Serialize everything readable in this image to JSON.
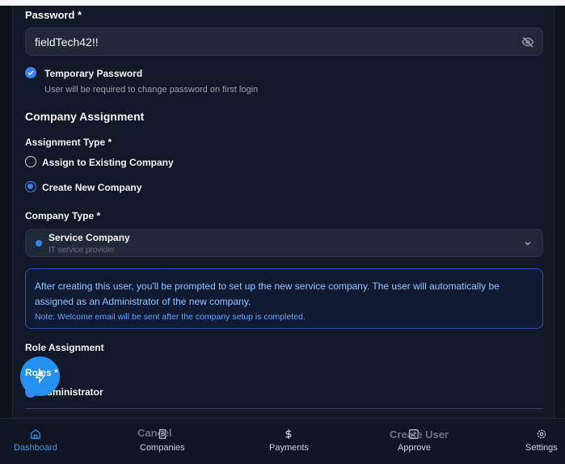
{
  "password": {
    "label": "Password *",
    "value": "fieldTech42!!"
  },
  "temporary": {
    "label": "Temporary Password",
    "hint": "User will be required to change password on first login"
  },
  "company": {
    "heading": "Company Assignment",
    "assignment_label": "Assignment Type *",
    "options": [
      "Assign to Existing Company",
      "Create New Company"
    ],
    "type_label": "Company Type *",
    "type_value": "Service Company",
    "type_desc": "IT service provider"
  },
  "info": {
    "text": "After creating this user, you'll be prompted to set up the new service company. The user will automatically be assigned as an Administrator of the new company.",
    "note": "Note: Welcome email will be sent after the company setup is completed."
  },
  "roles": {
    "heading": "Role Assignment",
    "label": "Roles *",
    "item": "Administrator"
  },
  "buttons": {
    "cancel": "Cancel",
    "create": "Create User"
  },
  "nav": [
    "Dashboard",
    "Companies",
    "Payments",
    "Approve",
    "Settings"
  ],
  "colors": {
    "accent": "#3b82f6",
    "fab": "#2491f0"
  }
}
